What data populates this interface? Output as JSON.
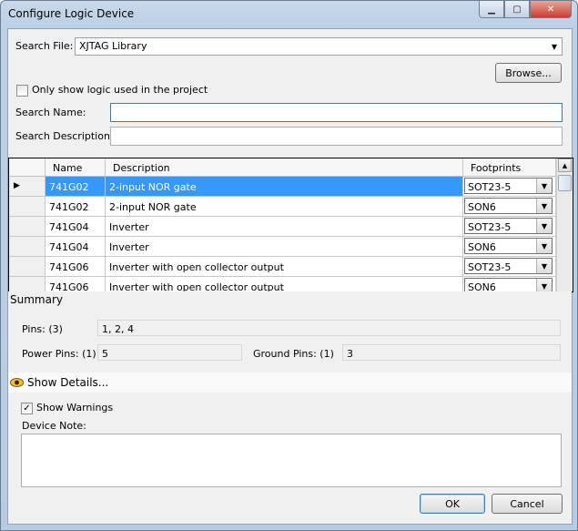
{
  "window": {
    "title": "Configure Logic Device",
    "min_icon": "minimize-icon",
    "max_icon": "maximize-icon",
    "close_icon": "close-icon"
  },
  "search_file": {
    "label": "Search File:",
    "value": "XJTAG Library"
  },
  "browse_label": "Browse...",
  "only_show": {
    "label": "Only show logic used in the project",
    "checked": false
  },
  "search_name": {
    "label": "Search Name:",
    "value": ""
  },
  "search_description": {
    "label": "Search Description:",
    "value": ""
  },
  "grid": {
    "headers": [
      "Name",
      "Description",
      "Footprints"
    ],
    "rows": [
      {
        "name": "741G02",
        "description": "2-input NOR gate",
        "footprint": "SOT23-5",
        "selected": true
      },
      {
        "name": "741G02",
        "description": "2-input NOR gate",
        "footprint": "SON6",
        "selected": false
      },
      {
        "name": "741G04",
        "description": "Inverter",
        "footprint": "SOT23-5",
        "selected": false
      },
      {
        "name": "741G04",
        "description": "Inverter",
        "footprint": "SON6",
        "selected": false
      },
      {
        "name": "741G06",
        "description": "Inverter with open collector output",
        "footprint": "SOT23-5",
        "selected": false
      },
      {
        "name": "741G06",
        "description": "Inverter with open collector output",
        "footprint": "SON6",
        "selected": false
      }
    ]
  },
  "summary": {
    "title": "Summary",
    "pins_label": "Pins: (3)",
    "pins_value": "1, 2, 4",
    "power_label": "Power Pins: (1)",
    "power_value": "5",
    "ground_label": "Ground Pins: (1)",
    "ground_value": "3"
  },
  "show_details": {
    "label": "Show Details...",
    "icon": "eye-icon"
  },
  "show_warnings": {
    "label": "Show Warnings",
    "checked": true
  },
  "device_note": {
    "label": "Device Note:",
    "value": ""
  },
  "ok_label": "OK",
  "cancel_label": "Cancel"
}
